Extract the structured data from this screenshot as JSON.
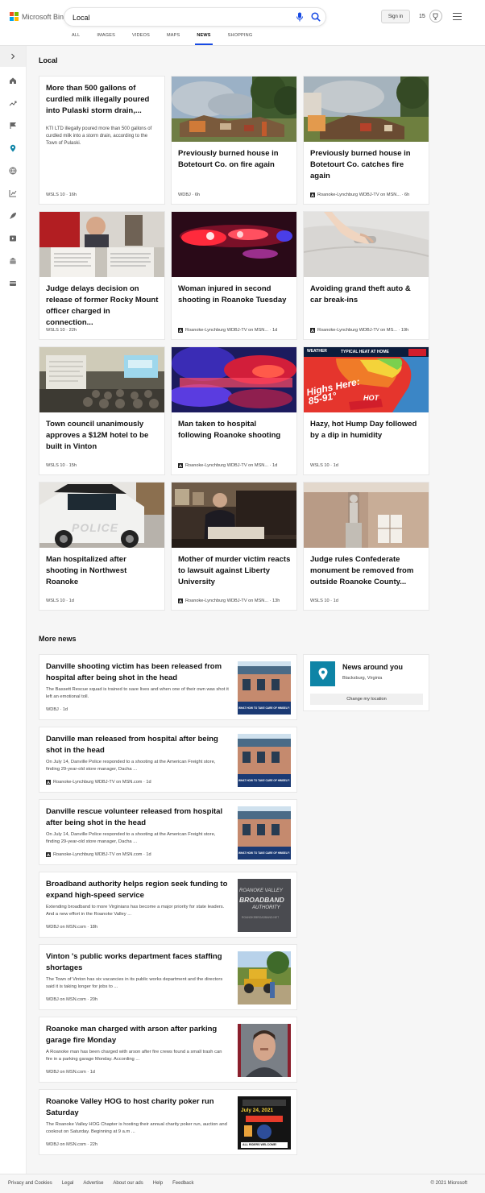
{
  "header": {
    "logo_text": "Microsoft Bing",
    "search_value": "Local",
    "signin_label": "Sign in",
    "rewards_count": "15",
    "tabs": [
      "ALL",
      "IMAGES",
      "VIDEOS",
      "MAPS",
      "NEWS",
      "SHOPPING"
    ],
    "active_tab": "NEWS"
  },
  "sidebar": {
    "items": [
      "expand",
      "home",
      "trending",
      "flag",
      "local",
      "world",
      "charts",
      "rocket",
      "video",
      "building",
      "card"
    ]
  },
  "local": {
    "title": "Local",
    "cards": [
      {
        "title": "More than 500 gallons of curdled milk illegally poured into Pulaski storm drain,...",
        "desc": "KTI LTD illegally poured more than 500 gallons of curdled milk into a storm drain, according to the Town of Pulaski.",
        "source": "WSLS 10 · 16h"
      },
      {
        "title": "Previously burned house in Botetourt Co. on fire again",
        "source": "WDBJ · 6h"
      },
      {
        "title": "Previously burned house in Botetourt Co. catches fire again",
        "source": "Roanoke-Lynchburg WDBJ-TV on MSN... · 6h"
      },
      {
        "title": "Judge delays decision on release of former Rocky Mount officer charged in connection...",
        "source": "WSLS 10 · 22h"
      },
      {
        "title": "Woman injured in second shooting in Roanoke Tuesday",
        "source": "Roanoke-Lynchburg WDBJ-TV on MSN... · 1d"
      },
      {
        "title": "Avoiding grand theft auto & car break-ins",
        "source": "Roanoke-Lynchburg WDBJ-TV on MS... · 19h"
      },
      {
        "title": "Town council unanimously approves a $12M hotel to be built in Vinton",
        "source": "WSLS 10 · 15h"
      },
      {
        "title": "Man taken to hospital following Roanoke shooting",
        "source": "Roanoke-Lynchburg WDBJ-TV on MSN... · 1d"
      },
      {
        "title": "Hazy, hot Hump Day followed by a dip in humidity",
        "source": "WSLS 10 · 1d",
        "img_text": {
          "top": "TYPICAL HEAT AT HOME",
          "big": "Highs Here: 85-91°",
          "hot": "HOT",
          "brand": "WEATHER"
        }
      },
      {
        "title": "Man hospitalized after shooting in Northwest Roanoke",
        "source": "WSLS 10 · 1d",
        "img_text": {
          "police": "POLICE"
        }
      },
      {
        "title": "Mother of murder victim reacts to lawsuit against Liberty University",
        "source": "Roanoke-Lynchburg WDBJ-TV on MSN... · 13h"
      },
      {
        "title": "Judge rules Confederate monument be removed from outside Roanoke County...",
        "source": "WSLS 10 · 1d"
      }
    ]
  },
  "more_news": {
    "title": "More news",
    "items": [
      {
        "title": "Danville shooting victim has been released from hospital after being shot in the head",
        "desc": "The Bassett Rescue squad is trained to save lives and when one of their own was shot it left an emotional toll.",
        "source": "WDBJ · 1d"
      },
      {
        "title": "Danville man released from hospital after being shot in the head",
        "desc": "On July 14, Danville Police responded to a shooting at the American Freight store, finding 29-year-old store manager, Dacha ...",
        "source": "Roanoke-Lynchburg WDBJ-TV on MSN.com · 1d"
      },
      {
        "title": "Danville rescue volunteer released from hospital after being shot in the head",
        "desc": "On July 14, Danville Police responded to a shooting at the American Freight store, finding 29-year-old store manager, Dacha ...",
        "source": "Roanoke-Lynchburg WDBJ-TV on MSN.com · 1d"
      },
      {
        "title": "Broadband authority helps region seek funding to expand high-speed service",
        "desc": "Extending broadband to more Virginians has become a major priority for state leaders. And a new effort in the Roanoke Valley ...",
        "source": "WDBJ on MSN.com · 18h",
        "img_text": {
          "l1": "ROANOKE VALLEY",
          "l2": "BROADBAND",
          "l3": "AUTHORITY",
          "l4": "ROANOKEBROADBAND.NET"
        }
      },
      {
        "title": "Vinton 's public works department faces staffing shortages",
        "desc": "The Town of Vinton has six vacancies in its public works department and the directors said it is taking longer for jobs to ...",
        "source": "WDBJ on MSN.com · 20h"
      },
      {
        "title": "Roanoke man charged with arson after parking garage fire Monday",
        "desc": "A Roanoke man has been charged with arson after fire crews found a small trash can fire in a parking garage Monday. According ...",
        "source": "WDBJ on MSN.com · 1d"
      },
      {
        "title": "Roanoke Valley HOG to host charity poker run Saturday",
        "desc": "The Roanoke Valley HOG Chapter is hosting their annual charity poker run, auction and cookout on Saturday. Beginning at 9 a.m ...",
        "source": "WDBJ on MSN.com · 22h",
        "img_text": {
          "date": "July 24, 2021",
          "bottom": "ALL RIDERS WELCOME!"
        }
      }
    ],
    "thumb_text": "WHAT HOW TO TAKE CARE OF HIMSELF PROP"
  },
  "news_around": {
    "title": "News around you",
    "location": "Blacksburg, Virginia",
    "button": "Change my location"
  },
  "footer": {
    "links": [
      "Privacy and Cookies",
      "Legal",
      "Advertise",
      "About our ads",
      "Help",
      "Feedback"
    ],
    "copyright": "© 2021 Microsoft"
  },
  "colors": {
    "accent": "#174ae4",
    "teal": "#0e84a6",
    "logo": [
      "#f25022",
      "#7fba00",
      "#00a4ef",
      "#ffb900"
    ]
  }
}
